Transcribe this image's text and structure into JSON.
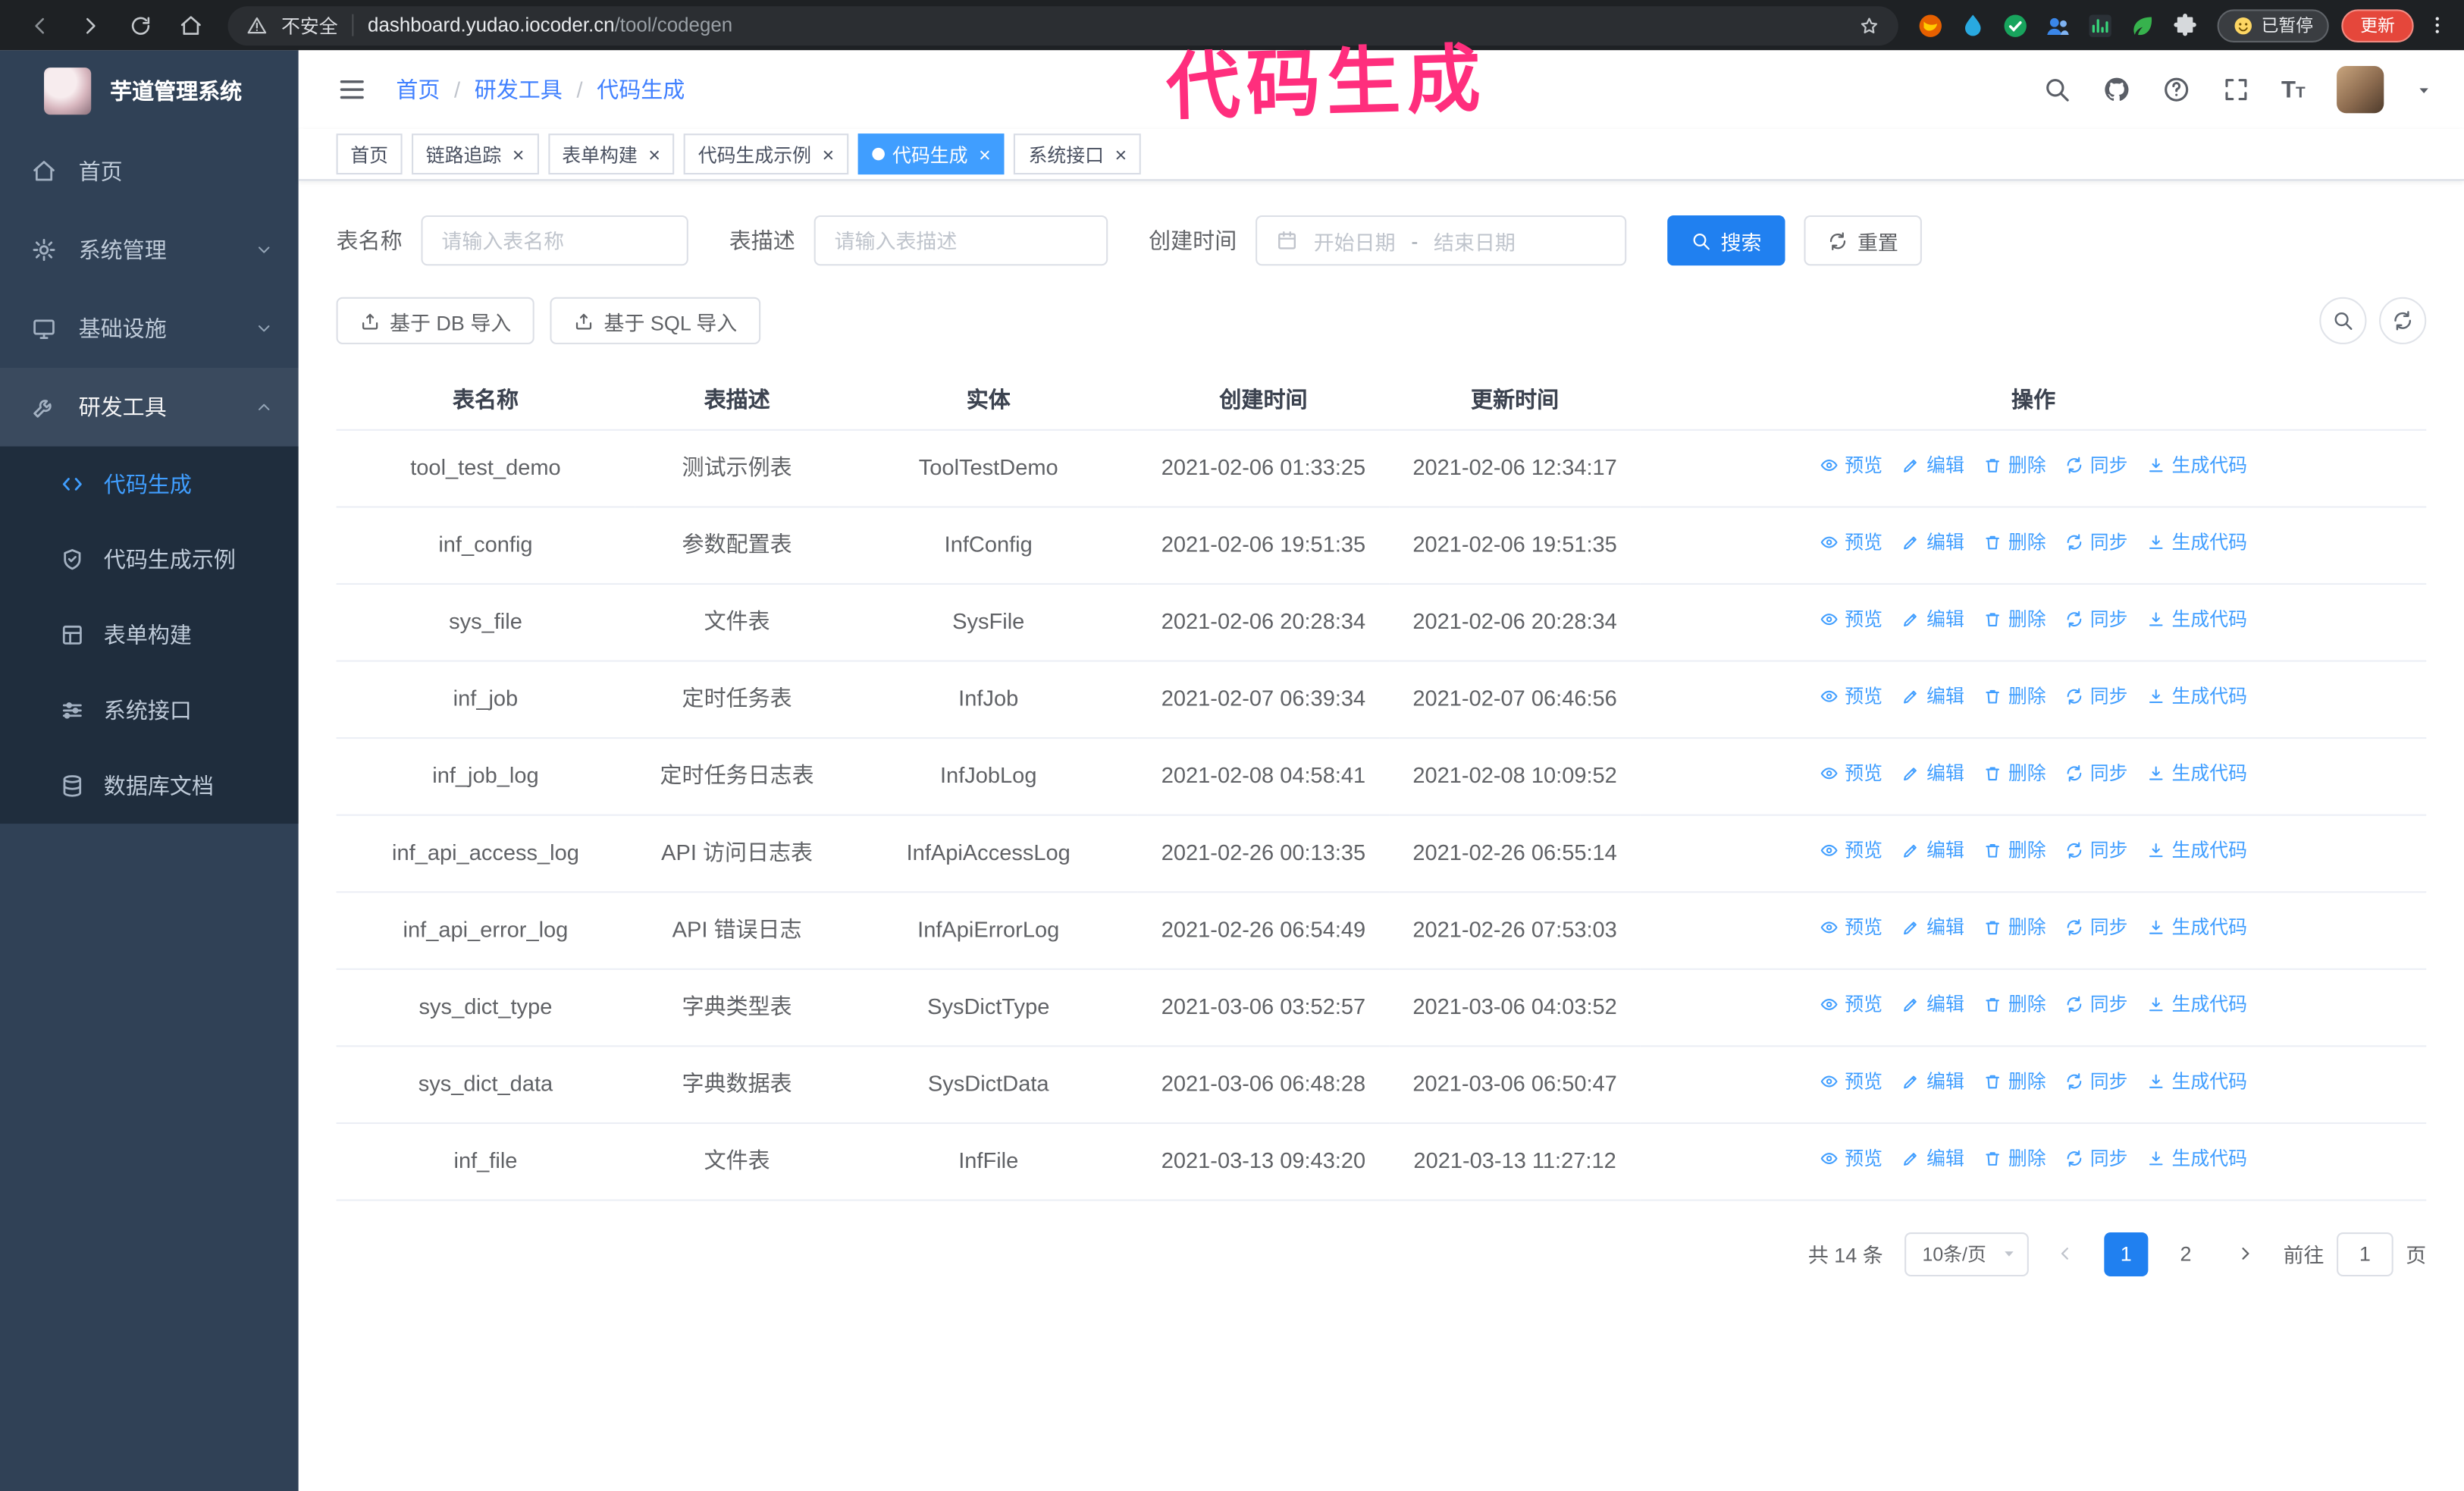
{
  "browser": {
    "security_text": "不安全",
    "url_host": "dashboard.yudao.iocoder.cn",
    "url_path": "/tool/codegen",
    "paused_badge": "已暂停",
    "update_button": "更新"
  },
  "annotation": {
    "text": "代码生成",
    "color": "#ff2e7d"
  },
  "sidebar": {
    "logo_title": "芋道管理系统",
    "menu": [
      {
        "key": "home",
        "label": "首页",
        "icon": "home-icon"
      },
      {
        "key": "system",
        "label": "系统管理",
        "icon": "gear-icon",
        "expandable": true
      },
      {
        "key": "infra",
        "label": "基础设施",
        "icon": "monitor-icon",
        "expandable": true
      },
      {
        "key": "dev-tools",
        "label": "研发工具",
        "icon": "wrench-icon",
        "expandable": true,
        "expanded": true,
        "children": [
          {
            "key": "codegen",
            "label": "代码生成",
            "icon": "code-icon",
            "active": true
          },
          {
            "key": "codegen-example",
            "label": "代码生成示例",
            "icon": "shield-icon"
          },
          {
            "key": "form-builder",
            "label": "表单构建",
            "icon": "form-grid-icon"
          },
          {
            "key": "system-api",
            "label": "系统接口",
            "icon": "sliders-icon"
          },
          {
            "key": "db-doc",
            "label": "数据库文档",
            "icon": "database-icon"
          }
        ]
      }
    ]
  },
  "header": {
    "breadcrumb": [
      "首页",
      "研发工具",
      "代码生成"
    ]
  },
  "tabs": [
    {
      "key": "home",
      "label": "首页",
      "closable": false,
      "active": false
    },
    {
      "key": "tracer",
      "label": "链路追踪",
      "closable": true,
      "active": false
    },
    {
      "key": "form-builder",
      "label": "表单构建",
      "closable": true,
      "active": false
    },
    {
      "key": "codegen-example",
      "label": "代码生成示例",
      "closable": true,
      "active": false
    },
    {
      "key": "codegen",
      "label": "代码生成",
      "closable": true,
      "active": true
    },
    {
      "key": "system-api",
      "label": "系统接口",
      "closable": true,
      "active": false
    }
  ],
  "filters": {
    "table_name_label": "表名称",
    "table_name_placeholder": "请输入表名称",
    "table_desc_label": "表描述",
    "table_desc_placeholder": "请输入表描述",
    "create_time_label": "创建时间",
    "date_start_placeholder": "开始日期",
    "date_separator": "-",
    "date_end_placeholder": "结束日期",
    "search_button": "搜索",
    "reset_button": "重置"
  },
  "toolbar": {
    "db_import_button": "基于 DB 导入",
    "sql_import_button": "基于 SQL 导入"
  },
  "table": {
    "columns": [
      "表名称",
      "表描述",
      "实体",
      "创建时间",
      "更新时间",
      "操作"
    ],
    "row_actions": [
      {
        "key": "preview",
        "label": "预览",
        "icon": "eye-icon"
      },
      {
        "key": "edit",
        "label": "编辑",
        "icon": "edit-icon"
      },
      {
        "key": "delete",
        "label": "删除",
        "icon": "trash-icon"
      },
      {
        "key": "sync",
        "label": "同步",
        "icon": "sync-icon"
      },
      {
        "key": "generate",
        "label": "生成代码",
        "icon": "download-icon"
      }
    ],
    "rows": [
      {
        "name": "tool_test_demo",
        "desc": "测试示例表",
        "entity": "ToolTestDemo",
        "created": "2021-02-06 01:33:25",
        "updated": "2021-02-06 12:34:17",
        "created_wrap": false,
        "updated_wrap": false
      },
      {
        "name": "inf_config",
        "desc": "参数配置表",
        "entity": "InfConfig",
        "created": "2021-02-06 19:51:35",
        "updated": "2021-02-06 19:51:35",
        "created_wrap": false,
        "updated_wrap": false
      },
      {
        "name": "sys_file",
        "desc": "文件表",
        "entity": "SysFile",
        "created": "2021-02-06 20:28:34",
        "updated": "2021-02-06 20:28:34",
        "created_wrap": true,
        "updated_wrap": true
      },
      {
        "name": "inf_job",
        "desc": "定时任务表",
        "entity": "InfJob",
        "created": "2021-02-07 06:39:34",
        "updated": "2021-02-07 06:46:56",
        "created_wrap": true,
        "updated_wrap": true
      },
      {
        "name": "inf_job_log",
        "desc": "定时任务日志表",
        "entity": "InfJobLog",
        "created": "2021-02-08 04:58:41",
        "updated": "2021-02-08 10:09:52",
        "created_wrap": true,
        "updated_wrap": true
      },
      {
        "name": "inf_api_access_log",
        "desc": "API 访问日志表",
        "entity": "InfApiAccessLog",
        "created": "2021-02-26 00:13:35",
        "updated": "2021-02-26 06:55:14",
        "created_wrap": false,
        "updated_wrap": true
      },
      {
        "name": "inf_api_error_log",
        "desc": "API 错误日志",
        "entity": "InfApiErrorLog",
        "created": "2021-02-26 06:54:49",
        "updated": "2021-02-26 07:53:03",
        "created_wrap": true,
        "updated_wrap": true
      },
      {
        "name": "sys_dict_type",
        "desc": "字典类型表",
        "entity": "SysDictType",
        "created": "2021-03-06 03:52:57",
        "updated": "2021-03-06 04:03:52",
        "created_wrap": true,
        "updated_wrap": true
      },
      {
        "name": "sys_dict_data",
        "desc": "字典数据表",
        "entity": "SysDictData",
        "created": "2021-03-06 06:48:28",
        "updated": "2021-03-06 06:50:47",
        "created_wrap": true,
        "updated_wrap": true
      },
      {
        "name": "inf_file",
        "desc": "文件表",
        "entity": "InfFile",
        "created": "2021-03-13 09:43:20",
        "updated": "2021-03-13 11:27:12",
        "created_wrap": true,
        "updated_wrap": false
      }
    ]
  },
  "pagination": {
    "total_text": "共 14 条",
    "page_size": "10条/页",
    "pages": [
      "1",
      "2"
    ],
    "active_page": "1",
    "goto_label": "前往",
    "goto_value": "1",
    "goto_unit": "页"
  }
}
